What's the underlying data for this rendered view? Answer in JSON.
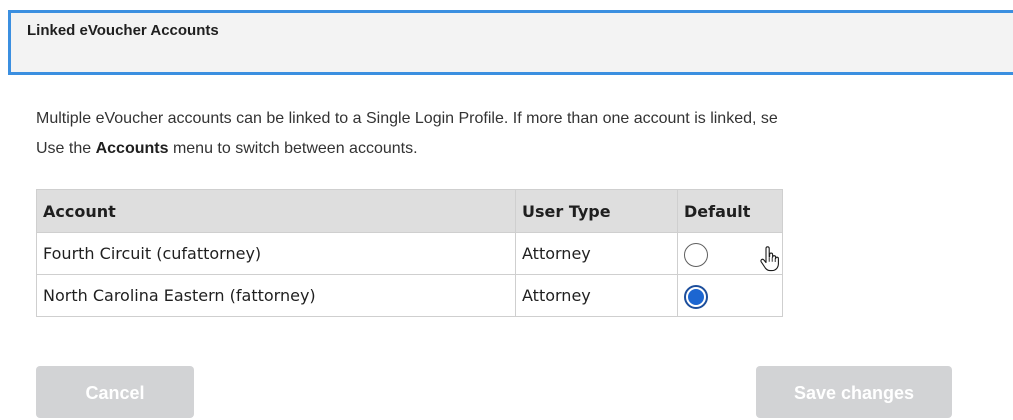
{
  "panel": {
    "title": "Linked eVoucher Accounts"
  },
  "intro": {
    "line1": "Multiple eVoucher accounts can be linked to a Single Login Profile. If more than one account is linked, se",
    "line2_prefix": "Use the ",
    "line2_bold": "Accounts",
    "line2_suffix": " menu to switch between accounts."
  },
  "table": {
    "headers": {
      "account": "Account",
      "user_type": "User Type",
      "default": "Default"
    },
    "rows": [
      {
        "account": "Fourth Circuit (cufattorney)",
        "user_type": "Attorney",
        "default_selected": false
      },
      {
        "account": "North Carolina Eastern (fattorney)",
        "user_type": "Attorney",
        "default_selected": true
      }
    ]
  },
  "buttons": {
    "cancel": "Cancel",
    "save": "Save changes"
  },
  "colors": {
    "header_border": "#3b8fe0",
    "radio_selected": "#1c66d1",
    "button_disabled": "#d2d3d5"
  },
  "icons": {
    "cursor": "hand-pointer-icon"
  }
}
